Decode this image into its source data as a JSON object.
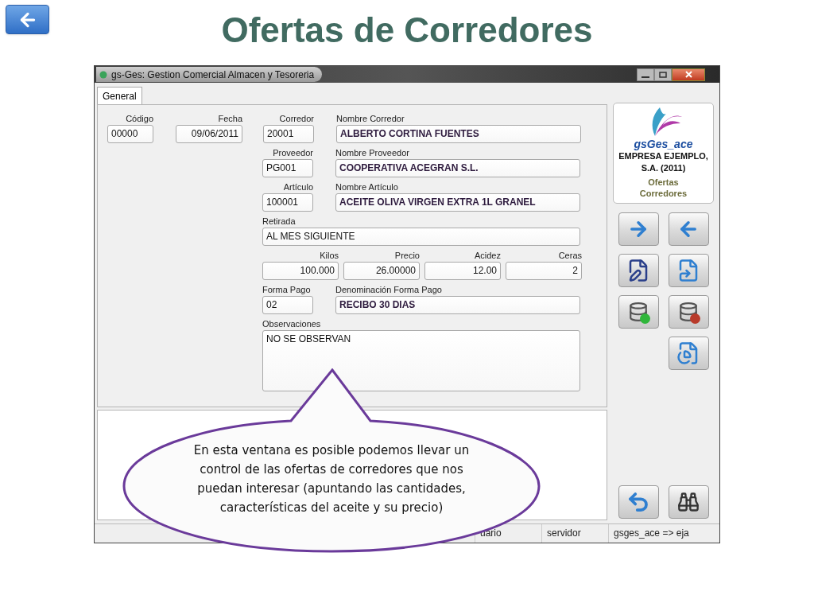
{
  "slide": {
    "title": "Ofertas de Corredores"
  },
  "window": {
    "title": "gs-Ges: Gestion Comercial Almacen y Tesoreria"
  },
  "tabs": [
    {
      "label": "General",
      "selected": true
    }
  ],
  "form": {
    "codigo": {
      "label": "Código",
      "value": "00000"
    },
    "fecha": {
      "label": "Fecha",
      "value": "09/06/2011"
    },
    "corredor": {
      "label": "Corredor",
      "value": "20001"
    },
    "nombre_corredor": {
      "label": "Nombre Corredor",
      "value": "ALBERTO CORTINA FUENTES"
    },
    "proveedor": {
      "label": "Proveedor",
      "value": "PG001"
    },
    "nombre_proveedor": {
      "label": "Nombre Proveedor",
      "value": "COOPERATIVA ACEGRAN S.L."
    },
    "articulo": {
      "label": "Artículo",
      "value": "100001"
    },
    "nombre_articulo": {
      "label": "Nombre Artículo",
      "value": "ACEITE OLIVA VIRGEN EXTRA 1L GRANEL"
    },
    "retirada": {
      "label": "Retirada",
      "value": "AL MES SIGUIENTE"
    },
    "kilos": {
      "label": "Kilos",
      "value": "100.000"
    },
    "precio": {
      "label": "Precio",
      "value": "26.00000"
    },
    "acidez": {
      "label": "Acidez",
      "value": "12.00"
    },
    "ceras": {
      "label": "Ceras",
      "value": "2"
    },
    "forma_pago": {
      "label": "Forma Pago",
      "value": "02"
    },
    "denominacion_forma_pago": {
      "label": "Denominación Forma Pago",
      "value": "RECIBO 30 DIAS"
    },
    "observaciones": {
      "label": "Observaciones",
      "value": "NO SE OBSERVAN"
    }
  },
  "logo_panel": {
    "app_name": "gsGes_ace",
    "company_lines": [
      "EMPRESA EJEMPLO,",
      "S.A. (2011)"
    ],
    "module_lines": [
      "Ofertas",
      "Corredores"
    ]
  },
  "status_bar": [
    "uario",
    "servidor",
    "gsges_ace => eja"
  ],
  "callout": {
    "text": "En esta ventana es posible podemos llevar un control de las ofertas de corredores que nos puedan interesar (apuntando las cantidades, características del aceite y su precio)"
  }
}
